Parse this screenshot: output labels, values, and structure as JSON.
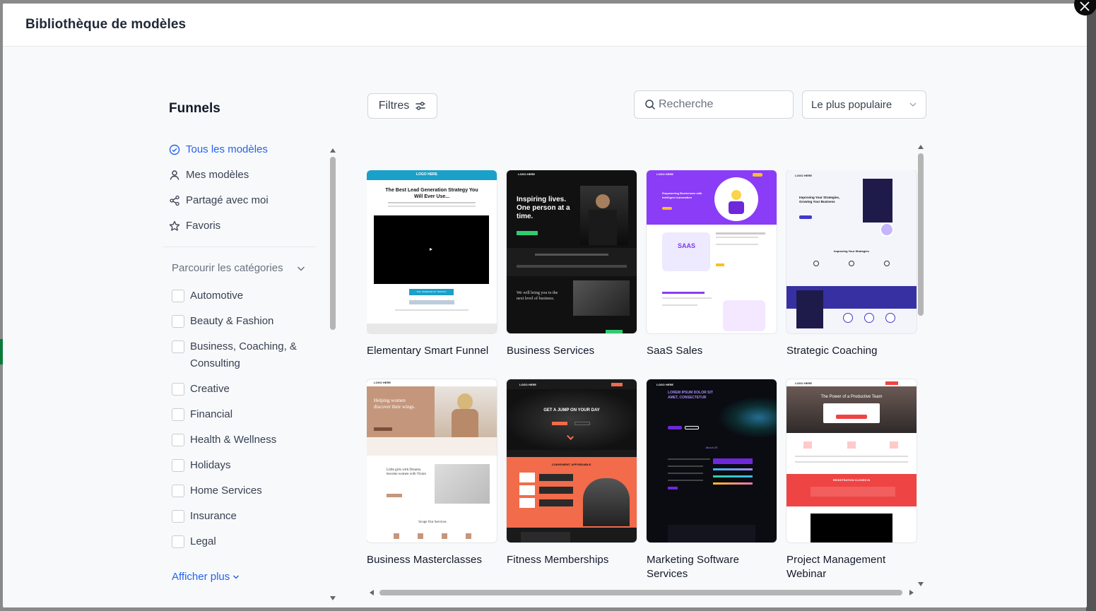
{
  "modal": {
    "title": "Bibliothèque de modèles"
  },
  "sidebar": {
    "title": "Funnels",
    "nav": [
      {
        "label": "Tous les modèles",
        "icon": "check-circle-icon",
        "active": true
      },
      {
        "label": "Mes modèles",
        "icon": "user-icon"
      },
      {
        "label": "Partagé avec moi",
        "icon": "share-icon"
      },
      {
        "label": "Favoris",
        "icon": "star-icon"
      }
    ],
    "categories_header": "Parcourir les catégories",
    "categories": [
      "Automotive",
      "Beauty & Fashion",
      "Business, Coaching, & Consulting",
      "Creative",
      "Financial",
      "Health & Wellness",
      "Holidays",
      "Home Services",
      "Insurance",
      "Legal"
    ],
    "show_more": "Afficher plus"
  },
  "toolbar": {
    "filter_label": "Filtres",
    "search_placeholder": "Recherche",
    "sort_value": "Le plus populaire"
  },
  "templates": [
    {
      "name": "Elementary Smart Funnel",
      "logo": "LOGO HERE",
      "headline": "The Best Lead Generation Strategy You Will Ever Use...",
      "cta": "YES, INCREASE MY TRAFFIC!"
    },
    {
      "name": "Business Services",
      "logo": "LOGO HERE",
      "headline": "Inspiring lives. One person at a time.",
      "subline": "We will bring you to the next level of business."
    },
    {
      "name": "SaaS Sales",
      "logo": "LOGO HERE",
      "headline": "Empowering Businesses with Intelligent Automation",
      "badge": "SAAS"
    },
    {
      "name": "Strategic Coaching",
      "logo": "LOGO HERE",
      "headline": "Improving Your Strategies, Growing Your Business",
      "section": "Improving Your Strategies"
    },
    {
      "name": "Business Masterclasses",
      "logo": "LOGO HERE",
      "headline": "Helping women discover their wings.",
      "subline": "Little girls with Dreams, become women with Vision",
      "section": "Scope Our Services"
    },
    {
      "name": "Fitness Memberships",
      "logo": "LOGO HERE",
      "headline": "GET A JUMP ON YOUR DAY",
      "subline": "CONVENIENT. AFFORDABLE."
    },
    {
      "name": "Marketing Software Services",
      "logo": "LOGO HERE",
      "headline": "LOREM IPSUM DOLOR SIT AMET, CONSECTETUR",
      "section": "About US"
    },
    {
      "name": "Project Management Webinar",
      "logo": "LOGO HERE",
      "headline": "The Power of a Productive Team",
      "section": "REGISTRATION CLOSES IN"
    }
  ],
  "colors": {
    "accent": "#2563eb",
    "close_bg": "#0b0b0b"
  }
}
